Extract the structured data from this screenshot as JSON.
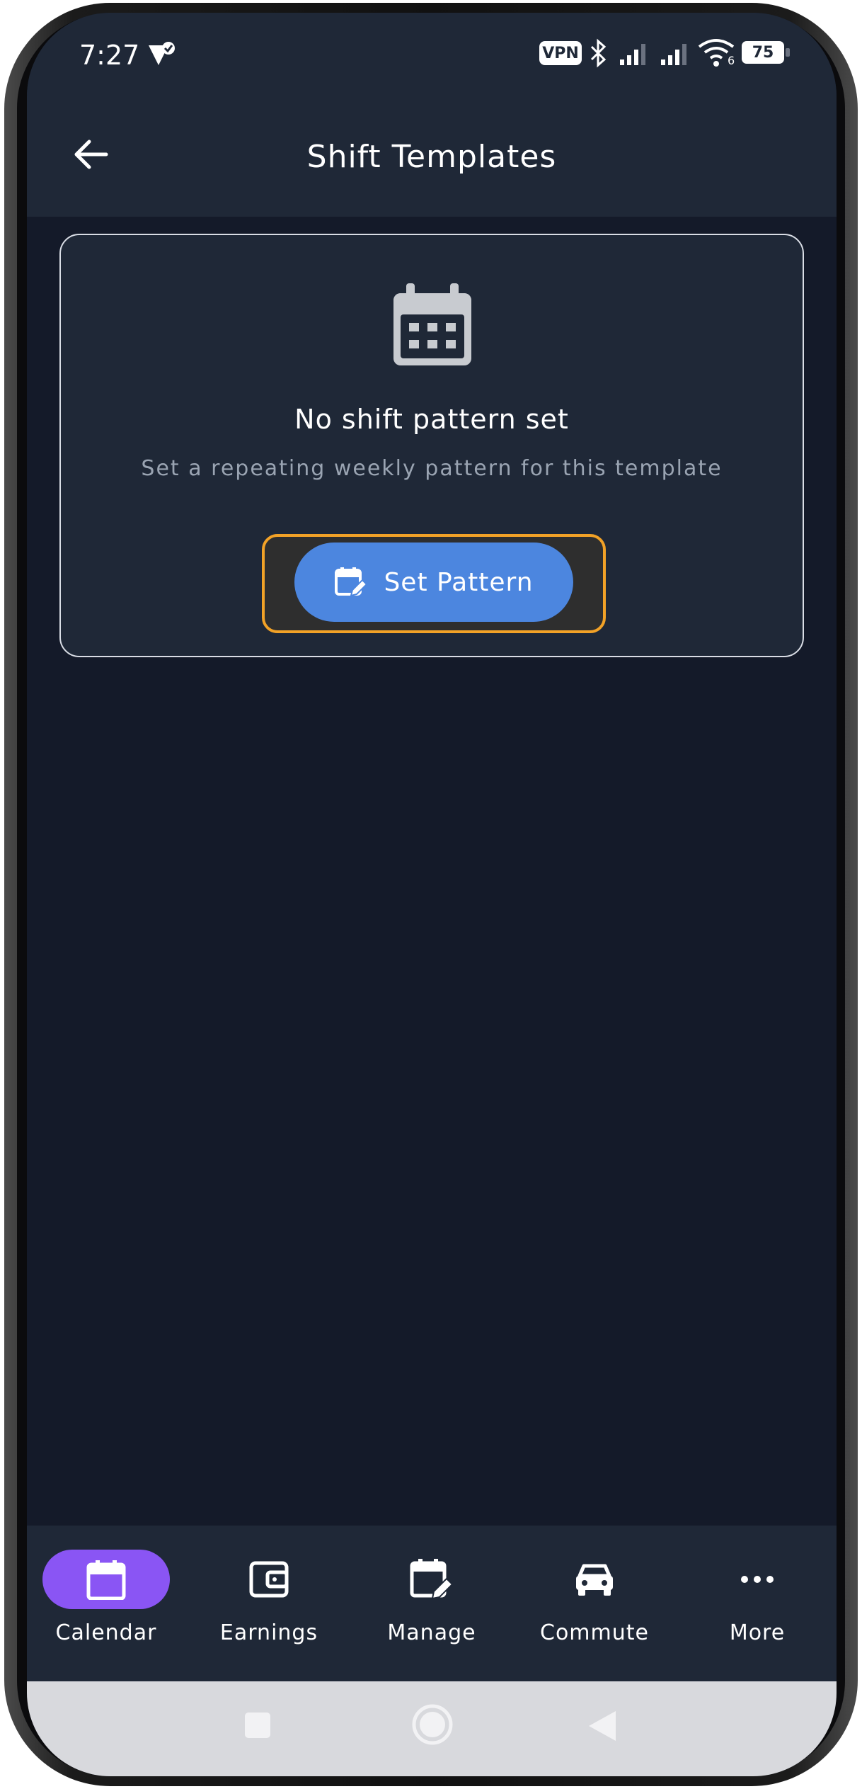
{
  "status_bar": {
    "time": "7:27",
    "vpn": "VPN",
    "network_generation": "6",
    "battery": "75"
  },
  "app_bar": {
    "title": "Shift Templates",
    "back_icon": "arrow-left-icon"
  },
  "empty_state": {
    "icon": "calendar-icon",
    "title": "No shift pattern set",
    "subtitle": "Set a repeating weekly pattern for this template",
    "button_label": "Set Pattern",
    "button_icon": "calendar-edit-icon"
  },
  "bottom_nav": {
    "items": [
      {
        "label": "Calendar",
        "icon": "calendar-icon",
        "selected": true
      },
      {
        "label": "Earnings",
        "icon": "wallet-icon",
        "selected": false
      },
      {
        "label": "Manage",
        "icon": "calendar-edit-icon",
        "selected": false
      },
      {
        "label": "Commute",
        "icon": "car-icon",
        "selected": false
      },
      {
        "label": "More",
        "icon": "more-horizontal-icon",
        "selected": false
      }
    ]
  },
  "colors": {
    "background": "#141a29",
    "surface": "#1f2837",
    "primary_button": "#4c86df",
    "selected_nav": "#8a55f4",
    "highlight_border": "#f2a227"
  }
}
